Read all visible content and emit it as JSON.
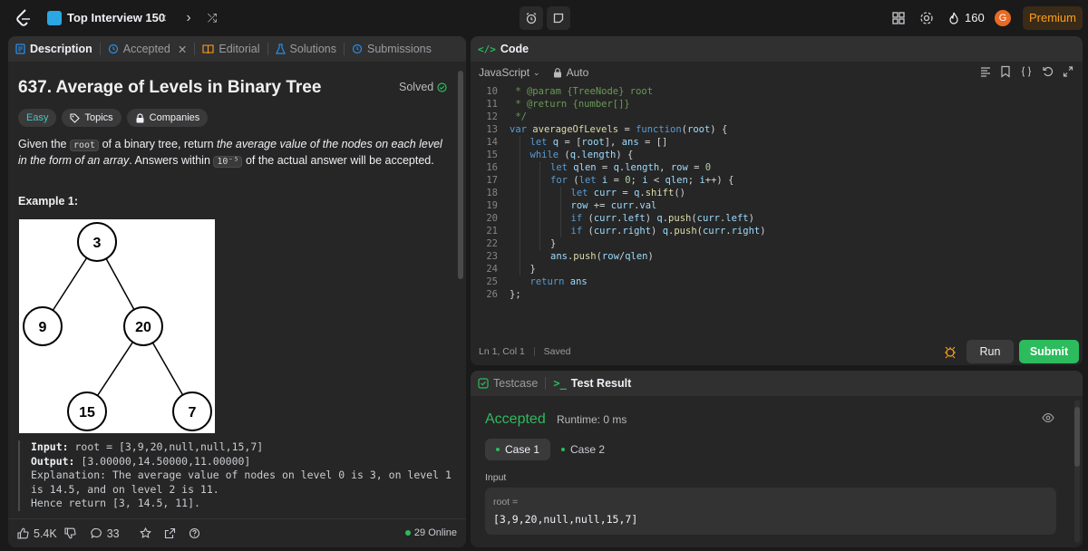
{
  "topbar": {
    "list_title": "Top Interview 150",
    "streak": "160",
    "avatar_letter": "G",
    "premium": "Premium"
  },
  "description": {
    "tabs": [
      {
        "label": "Description",
        "icon": "doc-icon"
      },
      {
        "label": "Accepted",
        "icon": "history-icon"
      },
      {
        "label": "Editorial",
        "icon": "book-icon"
      },
      {
        "label": "Solutions",
        "icon": "flask-icon"
      },
      {
        "label": "Submissions",
        "icon": "history-icon"
      }
    ],
    "title": "637. Average of Levels in Binary Tree",
    "solved": "Solved",
    "badges": {
      "difficulty": "Easy",
      "topics": "Topics",
      "companies": "Companies"
    },
    "text": {
      "p1": "Given the",
      "code1": "root",
      "p2": "of a binary tree, return",
      "em": "the average value of the nodes on each level in the form of an array",
      "p3": ". Answers within",
      "code2": "10⁻⁵",
      "p4": "of the actual answer will be accepted."
    },
    "example_title": "Example 1:",
    "tree_nodes": [
      "3",
      "9",
      "20",
      "15",
      "7"
    ],
    "example": {
      "input_label": "Input:",
      "input": "root = [3,9,20,null,null,15,7]",
      "output_label": "Output:",
      "output": "[3.00000,14.50000,11.00000]",
      "explanation": "Explanation: The average value of nodes on level 0 is 3, on level 1 is 14.5, and on level 2 is 11.",
      "hence": "Hence return [3, 14.5, 11]."
    },
    "footer": {
      "likes": "5.4K",
      "comments": "33",
      "online": "29 Online"
    }
  },
  "code": {
    "header": "Code",
    "language": "JavaScript",
    "auto": "Auto",
    "lines": [
      {
        "n": "10",
        "indent": 0,
        "html": "<span class=\"cm\"> * @param {TreeNode} root</span>"
      },
      {
        "n": "11",
        "indent": 0,
        "html": "<span class=\"cm\"> * @return {number[]}</span>"
      },
      {
        "n": "12",
        "indent": 0,
        "html": "<span class=\"cm\"> */</span>"
      },
      {
        "n": "13",
        "indent": 0,
        "html": "<span class=\"kw\">var</span> <span class=\"fn\">averageOfLevels</span> = <span class=\"kw\">function</span>(<span class=\"vr\">root</span>) {"
      },
      {
        "n": "14",
        "indent": 1,
        "html": "<span class=\"kw\">let</span> <span class=\"vr\">q</span> = [<span class=\"vr\">root</span>], <span class=\"vr\">ans</span> = []"
      },
      {
        "n": "15",
        "indent": 1,
        "html": "<span class=\"kw\">while</span> (<span class=\"vr\">q</span>.<span class=\"vr\">length</span>) {"
      },
      {
        "n": "16",
        "indent": 2,
        "html": "<span class=\"kw\">let</span> <span class=\"vr\">qlen</span> = <span class=\"vr\">q</span>.<span class=\"vr\">length</span>, <span class=\"vr\">row</span> = <span class=\"nm\">0</span>"
      },
      {
        "n": "17",
        "indent": 2,
        "html": "<span class=\"kw\">for</span> (<span class=\"kw\">let</span> <span class=\"vr\">i</span> = <span class=\"nm\">0</span>; <span class=\"vr\">i</span> &lt; <span class=\"vr\">qlen</span>; <span class=\"vr\">i</span>++) {"
      },
      {
        "n": "18",
        "indent": 3,
        "html": "<span class=\"kw\">let</span> <span class=\"vr\">curr</span> = <span class=\"vr\">q</span>.<span class=\"fn\">shift</span>()"
      },
      {
        "n": "19",
        "indent": 3,
        "html": "<span class=\"vr\">row</span> += <span class=\"vr\">curr</span>.<span class=\"vr\">val</span>"
      },
      {
        "n": "20",
        "indent": 3,
        "html": "<span class=\"kw\">if</span> (<span class=\"vr\">curr</span>.<span class=\"vr\">left</span>) <span class=\"vr\">q</span>.<span class=\"fn\">push</span>(<span class=\"vr\">curr</span>.<span class=\"vr\">left</span>)"
      },
      {
        "n": "21",
        "indent": 3,
        "html": "<span class=\"kw\">if</span> (<span class=\"vr\">curr</span>.<span class=\"vr\">right</span>) <span class=\"vr\">q</span>.<span class=\"fn\">push</span>(<span class=\"vr\">curr</span>.<span class=\"vr\">right</span>)"
      },
      {
        "n": "22",
        "indent": 2,
        "html": "}"
      },
      {
        "n": "23",
        "indent": 2,
        "html": "<span class=\"vr\">ans</span>.<span class=\"fn\">push</span>(<span class=\"vr\">row</span>/<span class=\"vr\">qlen</span>)"
      },
      {
        "n": "24",
        "indent": 1,
        "html": "}"
      },
      {
        "n": "25",
        "indent": 1,
        "html": "<span class=\"kw\">return</span> <span class=\"vr\">ans</span>"
      },
      {
        "n": "26",
        "indent": 0,
        "html": "};"
      }
    ],
    "status": "Ln 1, Col 1",
    "saved": "Saved",
    "run": "Run",
    "submit": "Submit"
  },
  "test": {
    "tabs": [
      {
        "label": "Testcase",
        "icon": "check-box-icon"
      },
      {
        "label": "Test Result",
        "icon": "terminal-icon"
      }
    ],
    "status": "Accepted",
    "runtime": "Runtime: 0 ms",
    "cases": [
      "Case 1",
      "Case 2"
    ],
    "input_label": "Input",
    "input_var": "root =",
    "input_value": "[3,9,20,null,null,15,7]"
  }
}
